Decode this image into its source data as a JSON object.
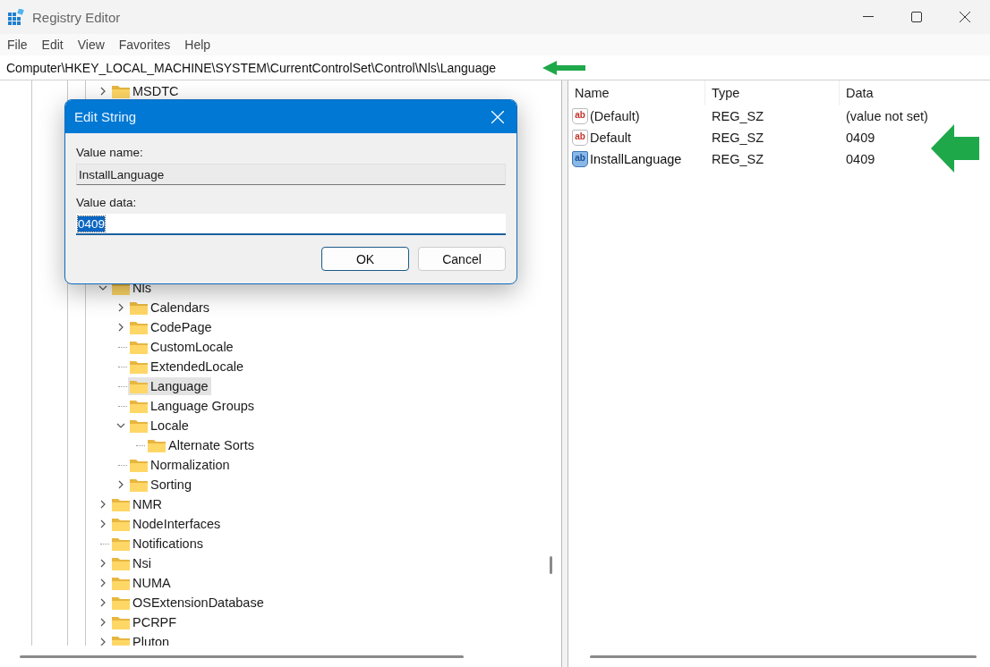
{
  "window": {
    "title": "Registry Editor"
  },
  "menu": [
    "File",
    "Edit",
    "View",
    "Favorites",
    "Help"
  ],
  "address": "Computer\\HKEY_LOCAL_MACHINE\\SYSTEM\\CurrentControlSet\\Control\\Nls\\Language",
  "tree": [
    {
      "label": "MSDTC",
      "expandable": true,
      "expanded": false,
      "selected": false
    },
    {
      "label": "Nls",
      "expandable": true,
      "expanded": true,
      "selected": false,
      "children": [
        {
          "label": "Calendars",
          "expandable": true,
          "expanded": false,
          "selected": false
        },
        {
          "label": "CodePage",
          "expandable": true,
          "expanded": false,
          "selected": false
        },
        {
          "label": "CustomLocale",
          "expandable": false,
          "selected": false
        },
        {
          "label": "ExtendedLocale",
          "expandable": false,
          "selected": false
        },
        {
          "label": "Language",
          "expandable": false,
          "selected": true
        },
        {
          "label": "Language Groups",
          "expandable": false,
          "selected": false
        },
        {
          "label": "Locale",
          "expandable": true,
          "expanded": true,
          "selected": false,
          "children": [
            {
              "label": "Alternate Sorts",
              "expandable": false,
              "selected": false
            }
          ]
        },
        {
          "label": "Normalization",
          "expandable": false,
          "selected": false
        },
        {
          "label": "Sorting",
          "expandable": true,
          "expanded": false,
          "selected": false
        }
      ]
    },
    {
      "label": "NMR",
      "expandable": true,
      "expanded": false,
      "selected": false
    },
    {
      "label": "NodeInterfaces",
      "expandable": true,
      "expanded": false,
      "selected": false
    },
    {
      "label": "Notifications",
      "expandable": false,
      "selected": false
    },
    {
      "label": "Nsi",
      "expandable": true,
      "expanded": false,
      "selected": false
    },
    {
      "label": "NUMA",
      "expandable": true,
      "expanded": false,
      "selected": false
    },
    {
      "label": "OSExtensionDatabase",
      "expandable": true,
      "expanded": false,
      "selected": false
    },
    {
      "label": "PCRPF",
      "expandable": true,
      "expanded": false,
      "selected": false
    },
    {
      "label": "Pluton",
      "expandable": true,
      "expanded": false,
      "selected": false
    }
  ],
  "values": {
    "columns": [
      "Name",
      "Type",
      "Data"
    ],
    "rows": [
      {
        "icon_text": "ab",
        "name": "(Default)",
        "type": "REG_SZ",
        "data": "(value not set)",
        "selected": false
      },
      {
        "icon_text": "ab",
        "name": "Default",
        "type": "REG_SZ",
        "data": "0409",
        "selected": false
      },
      {
        "icon_text": "ab",
        "name": "InstallLanguage",
        "type": "REG_SZ",
        "data": "0409",
        "selected": true
      }
    ]
  },
  "dialog": {
    "title": "Edit String",
    "fields": [
      {
        "label": "Value name:",
        "value": "InstallLanguage",
        "readonly": true,
        "text_selected": false
      },
      {
        "label": "Value data:",
        "value": "0409",
        "readonly": false,
        "text_selected": true
      }
    ],
    "buttons": [
      {
        "label": "OK",
        "default": true
      },
      {
        "label": "Cancel",
        "default": false
      }
    ]
  }
}
